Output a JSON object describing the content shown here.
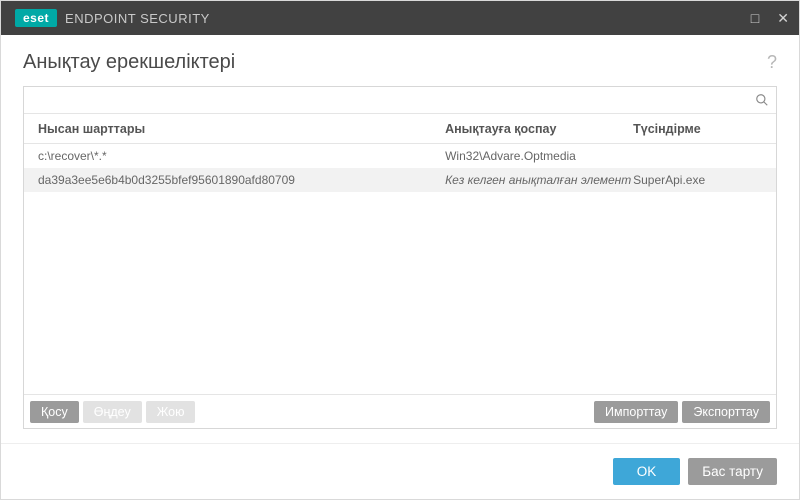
{
  "brand": {
    "badge": "eset",
    "name": "ENDPOINT SECURITY"
  },
  "page": {
    "title": "Анықтау ерекшеліктері",
    "help": "?"
  },
  "search": {
    "value": ""
  },
  "columns": {
    "criteria": "Нысан шарттары",
    "exclude": "Анықтауға қоспау",
    "comment": "Түсіндірме"
  },
  "rows": [
    {
      "criteria": "c:\\recover\\*.*",
      "exclude": "Win32\\Advare.Optmedia",
      "comment": "",
      "italic": false
    },
    {
      "criteria": "da39a3ee5e6b4b0d3255bfef95601890afd80709",
      "exclude": "Кез келген анықталған элемент",
      "comment": "SuperApi.exe",
      "italic": true
    }
  ],
  "actions": {
    "add": "Қосу",
    "edit": "Өңдеу",
    "delete": "Жою",
    "import": "Импорттау",
    "export": "Экспорттау"
  },
  "dialog": {
    "ok": "OK",
    "cancel": "Бас тарту"
  }
}
